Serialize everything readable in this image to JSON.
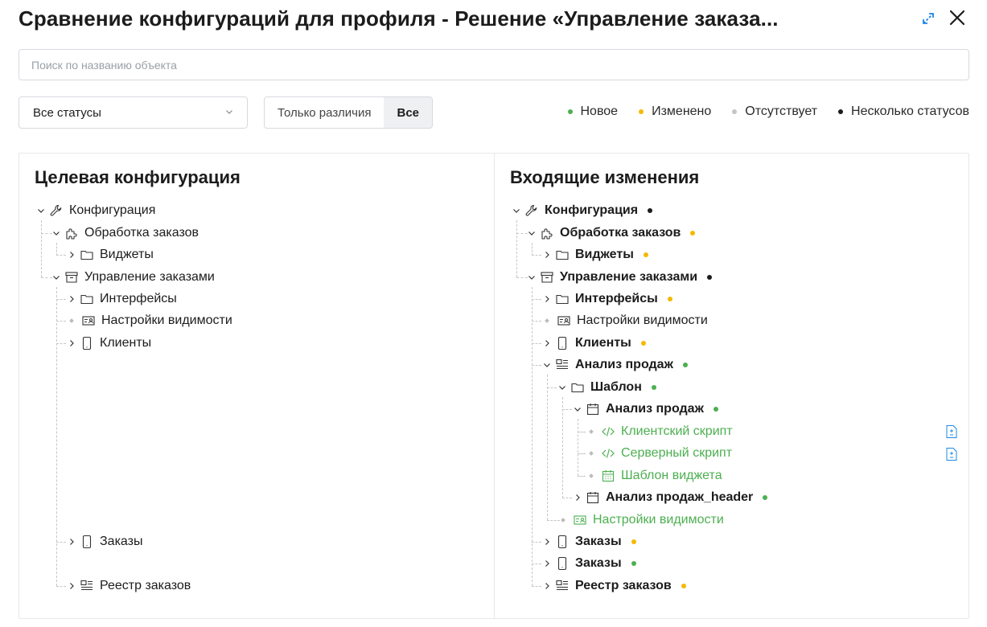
{
  "header": {
    "title": "Сравнение конфигураций для профиля - Решение «Управление заказа..."
  },
  "search": {
    "placeholder": "Поиск по названию объекта",
    "value": ""
  },
  "filters": {
    "status_select": "Все статусы",
    "toggle_diff": "Только различия",
    "toggle_all": "Все",
    "active_toggle": "Все"
  },
  "legend": [
    {
      "label": "Новое",
      "color": "#4caf50"
    },
    {
      "label": "Изменено",
      "color": "#f5b800"
    },
    {
      "label": "Отсутствует",
      "color": "#c4c4c4"
    },
    {
      "label": "Несколько статусов",
      "color": "#1c1c1c"
    }
  ],
  "left": {
    "title": "Целевая конфигурация",
    "items": [
      {
        "label": "Конфигурация",
        "icon": "wrench-icon"
      },
      {
        "label": "Обработка заказов",
        "icon": "puzzle-icon"
      },
      {
        "label": "Виджеты",
        "icon": "folder-icon"
      },
      {
        "label": "Управление заказами",
        "icon": "archive-icon"
      },
      {
        "label": "Интерфейсы",
        "icon": "folder-icon"
      },
      {
        "label": "Настройки видимости",
        "icon": "visibility-settings-icon"
      },
      {
        "label": "Клиенты",
        "icon": "phone-icon"
      },
      {
        "label": "Заказы",
        "icon": "phone-icon"
      },
      {
        "label": "Реестр заказов",
        "icon": "registry-icon"
      }
    ]
  },
  "right": {
    "title": "Входящие изменения",
    "items": [
      {
        "label": "Конфигурация",
        "icon": "wrench-icon",
        "status": "multiple"
      },
      {
        "label": "Обработка заказов",
        "icon": "puzzle-icon",
        "status": "changed"
      },
      {
        "label": "Виджеты",
        "icon": "folder-icon",
        "status": "changed"
      },
      {
        "label": "Управление заказами",
        "icon": "archive-icon",
        "status": "multiple"
      },
      {
        "label": "Интерфейсы",
        "icon": "folder-icon",
        "status": "changed"
      },
      {
        "label": "Настройки видимости",
        "icon": "visibility-settings-icon",
        "status": ""
      },
      {
        "label": "Клиенты",
        "icon": "phone-icon",
        "status": "changed"
      },
      {
        "label": "Анализ продаж",
        "icon": "registry-icon",
        "status": "new"
      },
      {
        "label": "Шаблон",
        "icon": "folder-icon",
        "status": "new"
      },
      {
        "label": "Анализ продаж",
        "icon": "calendar-icon",
        "status": "new"
      },
      {
        "label": "Клиентский скрипт",
        "icon": "code-icon",
        "status": "new-leaf"
      },
      {
        "label": "Серверный скрипт",
        "icon": "code-icon",
        "status": "new-leaf"
      },
      {
        "label": "Шаблон виджета",
        "icon": "widget-template-icon",
        "status": "new-leaf"
      },
      {
        "label": "Анализ продаж_header",
        "icon": "calendar-icon",
        "status": "new"
      },
      {
        "label": "Настройки видимости",
        "icon": "visibility-settings-icon",
        "status": "new-leaf"
      },
      {
        "label": "Заказы",
        "icon": "phone-icon",
        "status": "changed"
      },
      {
        "label": "Заказы",
        "icon": "phone-icon",
        "status": "new"
      },
      {
        "label": "Реестр заказов",
        "icon": "registry-icon",
        "status": "changed"
      }
    ]
  },
  "colors": {
    "new": "#4caf50",
    "changed": "#f5b800",
    "missing": "#c4c4c4",
    "multiple": "#1c1c1c",
    "accent": "#1e88e5"
  }
}
